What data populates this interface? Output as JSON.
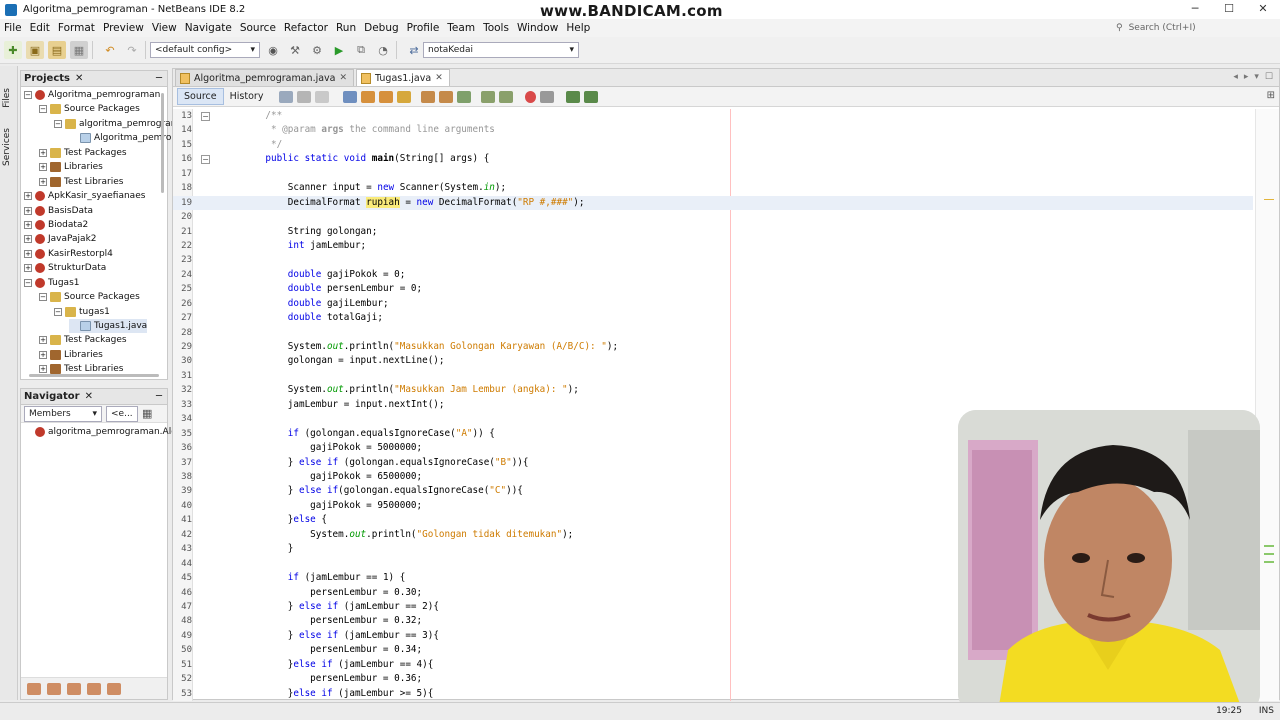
{
  "window": {
    "title": "Algoritma_pemrograman - NetBeans IDE 8.2",
    "watermark": "www.BANDICAM.com"
  },
  "menubar": {
    "items": [
      "File",
      "Edit",
      "Format",
      "Preview",
      "View",
      "Navigate",
      "Source",
      "Refactor",
      "Run",
      "Debug",
      "Profile",
      "Team",
      "Tools",
      "Window",
      "Help"
    ],
    "search_placeholder": "Search (Ctrl+I)"
  },
  "toolbar": {
    "config_value": "<default config>",
    "class_value": "notaKedai"
  },
  "side_tabs": {
    "files": "Files",
    "services": "Services"
  },
  "projects": {
    "title": "Projects",
    "tree": [
      {
        "label": "Algoritma_pemrograman",
        "kind": "proj",
        "depth": 0,
        "toggle": "−"
      },
      {
        "label": "Source Packages",
        "kind": "pkg",
        "depth": 1,
        "toggle": "−"
      },
      {
        "label": "algoritma_pemrograr",
        "kind": "pkg",
        "depth": 2,
        "toggle": "−"
      },
      {
        "label": "Algoritma_pemro",
        "kind": "file",
        "depth": 3,
        "toggle": ""
      },
      {
        "label": "Test Packages",
        "kind": "pkg",
        "depth": 1,
        "toggle": "+"
      },
      {
        "label": "Libraries",
        "kind": "lib",
        "depth": 1,
        "toggle": "+"
      },
      {
        "label": "Test Libraries",
        "kind": "lib",
        "depth": 1,
        "toggle": "+"
      },
      {
        "label": "ApkKasir_syaefianaes",
        "kind": "proj",
        "depth": 0,
        "toggle": "+"
      },
      {
        "label": "BasisData",
        "kind": "proj",
        "depth": 0,
        "toggle": "+"
      },
      {
        "label": "Biodata2",
        "kind": "proj",
        "depth": 0,
        "toggle": "+"
      },
      {
        "label": "JavaPajak2",
        "kind": "proj",
        "depth": 0,
        "toggle": "+"
      },
      {
        "label": "KasirRestorpl4",
        "kind": "proj",
        "depth": 0,
        "toggle": "+"
      },
      {
        "label": "StrukturData",
        "kind": "proj",
        "depth": 0,
        "toggle": "+"
      },
      {
        "label": "Tugas1",
        "kind": "proj",
        "depth": 0,
        "toggle": "−"
      },
      {
        "label": "Source Packages",
        "kind": "pkg",
        "depth": 1,
        "toggle": "−"
      },
      {
        "label": "tugas1",
        "kind": "pkg",
        "depth": 2,
        "toggle": "−"
      },
      {
        "label": "Tugas1.java",
        "kind": "file",
        "depth": 3,
        "toggle": "",
        "selected": true
      },
      {
        "label": "Test Packages",
        "kind": "pkg",
        "depth": 1,
        "toggle": "+"
      },
      {
        "label": "Libraries",
        "kind": "lib",
        "depth": 1,
        "toggle": "+"
      },
      {
        "label": "Test Libraries",
        "kind": "lib",
        "depth": 1,
        "toggle": "+"
      }
    ]
  },
  "navigator": {
    "title": "Navigator",
    "filter": "Members",
    "filter2": "<e...",
    "item": "algoritma_pemrograman.Algo"
  },
  "editor": {
    "tabs": [
      {
        "label": "Algoritma_pemrograman.java",
        "active": false
      },
      {
        "label": "Tugas1.java",
        "active": true
      }
    ],
    "modes": [
      "Source",
      "History"
    ],
    "current_line": 19,
    "lines": [
      {
        "n": 13,
        "html": "<span class='cm'>    /**</span>"
      },
      {
        "n": 14,
        "html": "<span class='cm'>     * @param <b>args</b> the command line arguments</span>"
      },
      {
        "n": 15,
        "html": "<span class='cm'>     */</span>"
      },
      {
        "n": 16,
        "html": "    <span class='kw'>public static void</span> <span class='bold'>main</span>(String[] args) {"
      },
      {
        "n": 17,
        "html": ""
      },
      {
        "n": 18,
        "html": "        Scanner input = <span class='kw'>new</span> Scanner(System.<span class='fld'>in</span>);"
      },
      {
        "n": 19,
        "html": "        DecimalFormat <span class='hl'>rupiah</span> = <span class='kw'>new</span> DecimalFormat(<span class='str'>\"RP #,###\"</span>);"
      },
      {
        "n": 20,
        "html": ""
      },
      {
        "n": 21,
        "html": "        String golongan;"
      },
      {
        "n": 22,
        "html": "        <span class='kw'>int</span> jamLembur;"
      },
      {
        "n": 23,
        "html": ""
      },
      {
        "n": 24,
        "html": "        <span class='kw'>double</span> gajiPokok = 0;"
      },
      {
        "n": 25,
        "html": "        <span class='kw'>double</span> persenLembur = 0;"
      },
      {
        "n": 26,
        "html": "        <span class='kw'>double</span> gajiLembur;"
      },
      {
        "n": 27,
        "html": "        <span class='kw'>double</span> totalGaji;"
      },
      {
        "n": 28,
        "html": ""
      },
      {
        "n": 29,
        "html": "        System.<span class='fld'>out</span>.println(<span class='str'>\"Masukkan Golongan Karyawan (A/B/C): \"</span>);"
      },
      {
        "n": 30,
        "html": "        golongan = input.nextLine();"
      },
      {
        "n": 31,
        "html": ""
      },
      {
        "n": 32,
        "html": "        System.<span class='fld'>out</span>.println(<span class='str'>\"Masukkan Jam Lembur (angka): \"</span>);"
      },
      {
        "n": 33,
        "html": "        jamLembur = input.nextInt();"
      },
      {
        "n": 34,
        "html": ""
      },
      {
        "n": 35,
        "html": "        <span class='kw'>if</span> (golongan.equalsIgnoreCase(<span class='str'>\"A\"</span>)) {"
      },
      {
        "n": 36,
        "html": "            gajiPokok = 5000000;"
      },
      {
        "n": 37,
        "html": "        } <span class='kw'>else if</span> (golongan.equalsIgnoreCase(<span class='str'>\"B\"</span>)){"
      },
      {
        "n": 38,
        "html": "            gajiPokok = 6500000;"
      },
      {
        "n": 39,
        "html": "        } <span class='kw'>else if</span>(golongan.equalsIgnoreCase(<span class='str'>\"C\"</span>)){"
      },
      {
        "n": 40,
        "html": "            gajiPokok = 9500000;"
      },
      {
        "n": 41,
        "html": "        }<span class='kw'>else</span> {"
      },
      {
        "n": 42,
        "html": "            System.<span class='fld'>out</span>.println(<span class='str'>\"Golongan tidak ditemukan\"</span>);"
      },
      {
        "n": 43,
        "html": "        }"
      },
      {
        "n": 44,
        "html": ""
      },
      {
        "n": 45,
        "html": "        <span class='kw'>if</span> (jamLembur == 1) {"
      },
      {
        "n": 46,
        "html": "            persenLembur = 0.30;"
      },
      {
        "n": 47,
        "html": "        } <span class='kw'>else if</span> (jamLembur == 2){"
      },
      {
        "n": 48,
        "html": "            persenLembur = 0.32;"
      },
      {
        "n": 49,
        "html": "        } <span class='kw'>else if</span> (jamLembur == 3){"
      },
      {
        "n": 50,
        "html": "            persenLembur = 0.34;"
      },
      {
        "n": 51,
        "html": "        }<span class='kw'>else if</span> (jamLembur == 4){"
      },
      {
        "n": 52,
        "html": "            persenLembur = 0.36;"
      },
      {
        "n": 53,
        "html": "        }<span class='kw'>else if</span> (jamLembur >= 5){"
      }
    ]
  },
  "statusbar": {
    "position": "19:25",
    "mode": "INS"
  },
  "colors": {
    "keyword": "#0000e6",
    "string": "#ce7b00",
    "comment": "#969696",
    "field": "#009900",
    "highlight": "#faeb7a"
  }
}
